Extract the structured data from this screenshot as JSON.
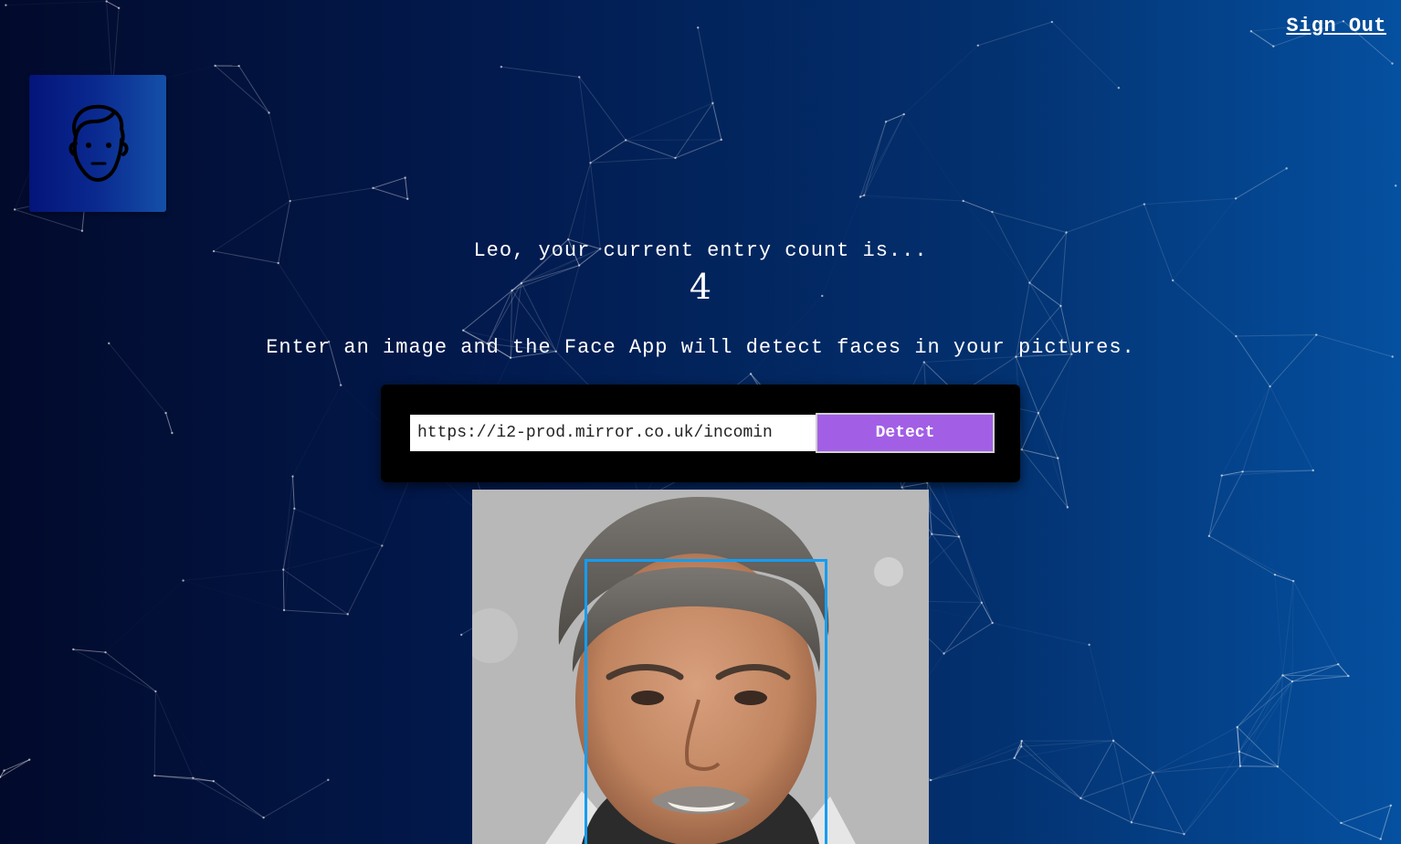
{
  "header": {
    "signout_label": "Sign Out"
  },
  "logo": {
    "icon": "face-icon"
  },
  "rank": {
    "greeting": "Leo, your current entry count is...",
    "count": "4"
  },
  "instructions": "Enter an image and the Face App will detect faces in your pictures.",
  "form": {
    "url_value": "https://i2-prod.mirror.co.uk/incomin",
    "detect_label": "Detect"
  },
  "colors": {
    "button": "#a25fe6",
    "face_box": "#149df2"
  }
}
